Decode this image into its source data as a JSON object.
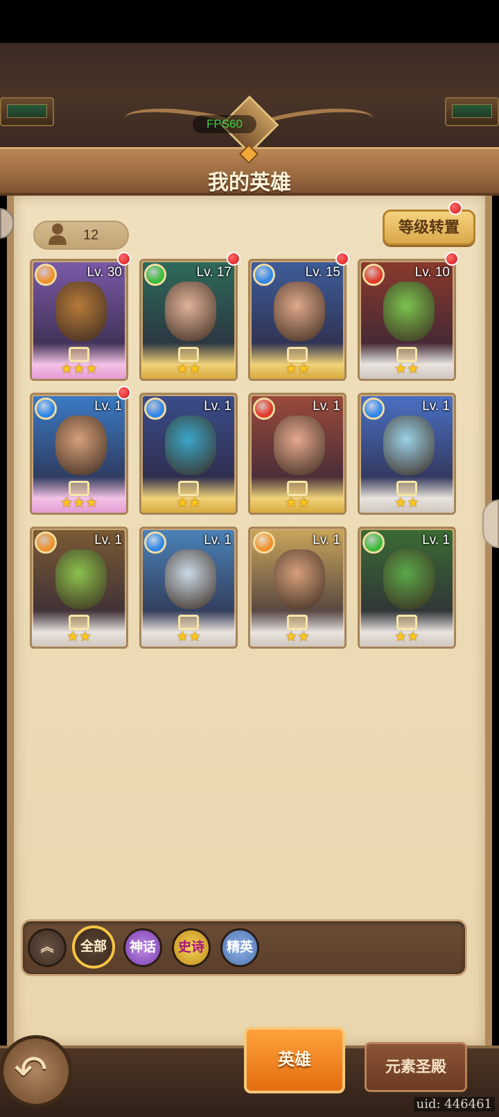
{
  "overlay": {
    "fps_label": "FPS60"
  },
  "header": {
    "title": "我的英雄"
  },
  "toolbar": {
    "hero_count": "12",
    "level_transfer_label": "等级转置"
  },
  "heroes": [
    {
      "level": "Lv. 30",
      "element": "earth",
      "element_color": "#f0922a",
      "stars": "★★★",
      "rarity": "mythic",
      "bg": "#7a5aa8",
      "face": "#b77a3a",
      "badge": true
    },
    {
      "level": "Lv. 17",
      "element": "wind",
      "element_color": "#3dbb3a",
      "stars": "★★",
      "rarity": "epic",
      "bg": "#2e6a5a",
      "face": "#e2b39a",
      "badge": true
    },
    {
      "level": "Lv. 15",
      "element": "water",
      "element_color": "#2f86e6",
      "stars": "★★",
      "rarity": "epic",
      "bg": "#3e5d9a",
      "face": "#e0a98a",
      "badge": true
    },
    {
      "level": "Lv. 10",
      "element": "fire",
      "element_color": "#e23a2a",
      "stars": "★★",
      "rarity": "elite",
      "bg": "#8a3a2c",
      "face": "#7cc24e",
      "badge": true
    },
    {
      "level": "Lv. 1",
      "element": "water",
      "element_color": "#2f86e6",
      "stars": "★★★",
      "rarity": "mythic",
      "bg": "#3a7ac4",
      "face": "#d7a07a",
      "badge": true
    },
    {
      "level": "Lv. 1",
      "element": "water",
      "element_color": "#2f86e6",
      "stars": "★★",
      "rarity": "epic",
      "bg": "#3a4c8a",
      "face": "#3aa6c8",
      "badge": false
    },
    {
      "level": "Lv. 1",
      "element": "fire",
      "element_color": "#e23a2a",
      "stars": "★★",
      "rarity": "epic",
      "bg": "#9a4a3a",
      "face": "#e7a98e",
      "badge": false
    },
    {
      "level": "Lv. 1",
      "element": "water",
      "element_color": "#2f86e6",
      "stars": "★★",
      "rarity": "elite",
      "bg": "#4a70c4",
      "face": "#9ad0e6",
      "badge": false
    },
    {
      "level": "Lv. 1",
      "element": "earth",
      "element_color": "#f0922a",
      "stars": "★★",
      "rarity": "elite",
      "bg": "#7a5a34",
      "face": "#8cc24e",
      "badge": false
    },
    {
      "level": "Lv. 1",
      "element": "water",
      "element_color": "#2f86e6",
      "stars": "★★",
      "rarity": "elite",
      "bg": "#4a82b8",
      "face": "#c9d9e6",
      "badge": false
    },
    {
      "level": "Lv. 1",
      "element": "earth",
      "element_color": "#f0922a",
      "stars": "★★",
      "rarity": "elite",
      "bg": "#c9a45a",
      "face": "#d7a07a",
      "badge": false
    },
    {
      "level": "Lv. 1",
      "element": "wind",
      "element_color": "#3dbb3a",
      "stars": "★★",
      "rarity": "elite",
      "bg": "#3c6a34",
      "face": "#5aa84a",
      "badge": false
    }
  ],
  "filters": [
    {
      "label": "全部",
      "key": "all",
      "selected": true
    },
    {
      "label": "神话",
      "key": "mythic"
    },
    {
      "label": "史诗",
      "key": "epic"
    },
    {
      "label": "精英",
      "key": "elite"
    }
  ],
  "bottom_nav": {
    "heroes_tab": "英雄",
    "temple_tab": "元素圣殿",
    "back_icon": "back-arrow-icon"
  },
  "footer": {
    "uid": "uid: 446461"
  }
}
